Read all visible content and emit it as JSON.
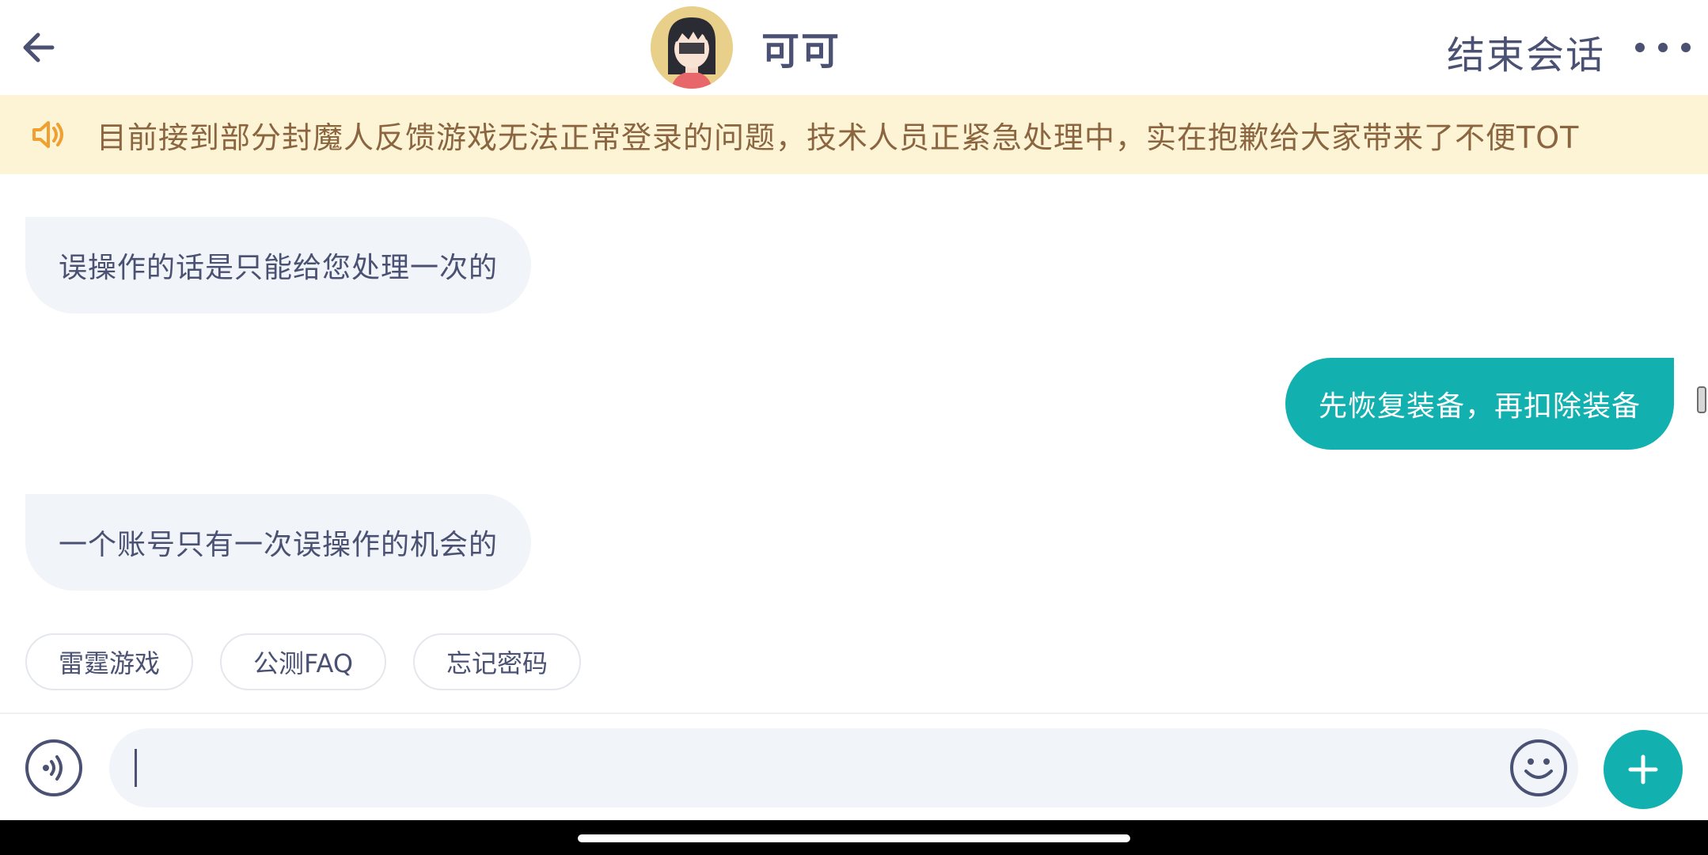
{
  "header": {
    "agent_name": "可可",
    "end_chat_label": "结束会话"
  },
  "notice": {
    "icon": "speaker-icon",
    "text": "目前接到部分封魔人反馈游戏无法正常登录的问题，技术人员正紧急处理中，实在抱歉给大家带来了不便TOT"
  },
  "messages": [
    {
      "from": "agent",
      "text": "误操作的话是只能给您处理一次的"
    },
    {
      "from": "user",
      "text": "先恢复装备，再扣除装备"
    },
    {
      "from": "agent",
      "text": "一个账号只有一次误操作的机会的"
    }
  ],
  "quick_replies": [
    "雷霆游戏",
    "公测FAQ",
    "忘记密码"
  ],
  "input": {
    "value": "",
    "placeholder": ""
  },
  "colors": {
    "accent": "#13b0b0",
    "text": "#4a5173",
    "notice_bg": "#fdf4d6",
    "notice_text": "#8a6540",
    "notice_icon": "#f0a030",
    "agent_bubble": "#f1f4f8"
  },
  "icons": {
    "back": "arrow-left-icon",
    "more": "more-dots-icon",
    "voice": "voice-icon",
    "emoji": "emoji-icon",
    "plus": "plus-icon"
  }
}
